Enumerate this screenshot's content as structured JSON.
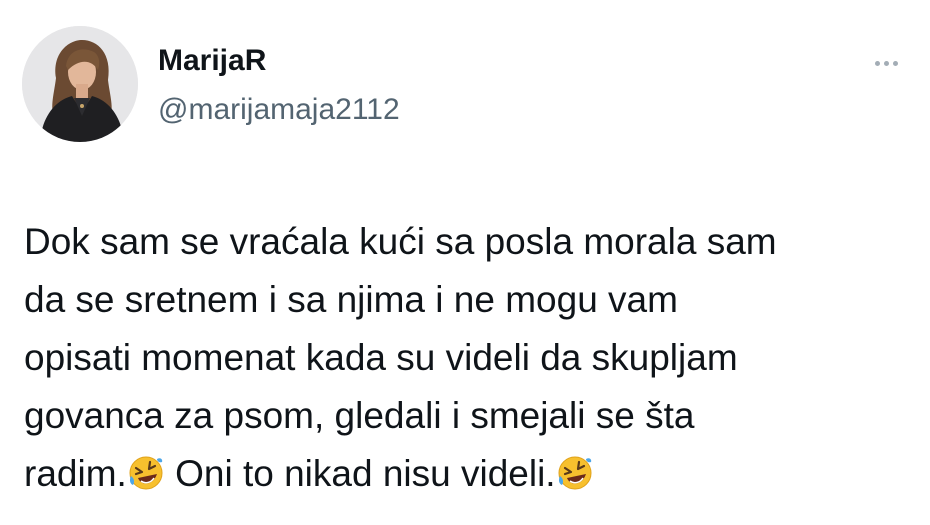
{
  "author": {
    "display_name": "MarijaR",
    "handle": "@marijamaja2112",
    "avatar_icon": "profile-photo-avatar"
  },
  "menu": {
    "icon": "more-options-icon"
  },
  "tweet": {
    "lines": [
      "Dok sam se vraćala kući sa posla morala sam",
      "da se sretnem i sa njima i ne mogu vam",
      "opisati momenat kada su videli da skupljam",
      "govanca za psom, gledali i smejali se šta"
    ],
    "last_line_part1": "radim.",
    "last_line_part2": " Oni to nikad nisu videli.",
    "emoji_name": "rolling-on-floor-laughing-emoji"
  },
  "colors": {
    "text": "#0f1419",
    "secondary": "#536471",
    "menu_dots": "#a3adb6",
    "emoji": "#f7c02e"
  }
}
